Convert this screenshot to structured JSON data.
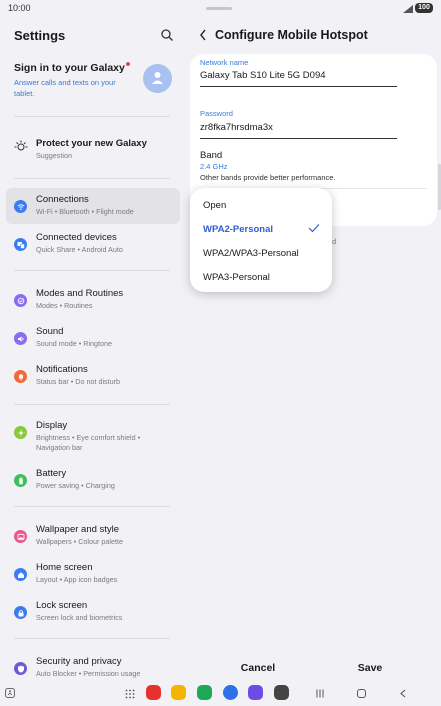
{
  "status": {
    "time": "10:00",
    "battery": "100"
  },
  "left": {
    "title": "Settings",
    "account": {
      "title": "Sign in to your Galaxy",
      "subtitle": "Answer calls and texts on your tablet."
    },
    "suggestion": {
      "title": "Protect your new Galaxy",
      "subtitle": "Suggestion"
    },
    "items": [
      {
        "title": "Connections",
        "subtitle": "Wi-Fi  •  Bluetooth  •  Flight mode",
        "color": "#3b7cf0",
        "icon": "wifi-icon"
      },
      {
        "title": "Connected devices",
        "subtitle": "Quick Share  •  Android Auto",
        "color": "#3b7cf0",
        "icon": "devices-icon"
      },
      {
        "title": "Modes and Routines",
        "subtitle": "Modes  •  Routines",
        "color": "#8b6cf0",
        "icon": "modes-icon"
      },
      {
        "title": "Sound",
        "subtitle": "Sound mode  •  Ringtone",
        "color": "#8b6cf0",
        "icon": "sound-icon"
      },
      {
        "title": "Notifications",
        "subtitle": "Status bar  •  Do not disturb",
        "color": "#f06a3c",
        "icon": "notification-icon"
      },
      {
        "title": "Display",
        "subtitle": "Brightness  •  Eye comfort shield  •",
        "subtitle2": "Navigation bar",
        "color": "#86c93a",
        "icon": "display-icon"
      },
      {
        "title": "Battery",
        "subtitle": "Power saving  •  Charging",
        "color": "#3fbf5c",
        "icon": "battery-icon"
      },
      {
        "title": "Wallpaper and style",
        "subtitle": "Wallpapers  •  Colour palette",
        "color": "#e8578a",
        "icon": "wallpaper-icon"
      },
      {
        "title": "Home screen",
        "subtitle": "Layout  •  App icon badges",
        "color": "#3b7cf0",
        "icon": "home-icon"
      },
      {
        "title": "Lock screen",
        "subtitle": "Screen lock and biometrics",
        "color": "#3b7cf0",
        "icon": "lock-icon"
      },
      {
        "title": "Security and privacy",
        "subtitle": "Auto Blocker  •  Permission usage",
        "color": "#6a5cd6",
        "icon": "security-icon"
      }
    ]
  },
  "right": {
    "title": "Configure Mobile Hotspot",
    "network_name_label": "Network name",
    "network_name": "Galaxy Tab S10 Lite 5G D094",
    "password_label": "Password",
    "password": "zr8fka7hrsdma3x",
    "band_label": "Band",
    "band_value": "2.4 GHz",
    "band_note": "Other bands provide better performance.",
    "peek_char": "d",
    "security_options": [
      "Open",
      "WPA2-Personal",
      "WPA2/WPA3-Personal",
      "WPA3-Personal"
    ],
    "selected_option": "WPA2-Personal",
    "cancel_label": "Cancel",
    "save_label": "Save"
  },
  "accent_color": "#2d5fcf"
}
